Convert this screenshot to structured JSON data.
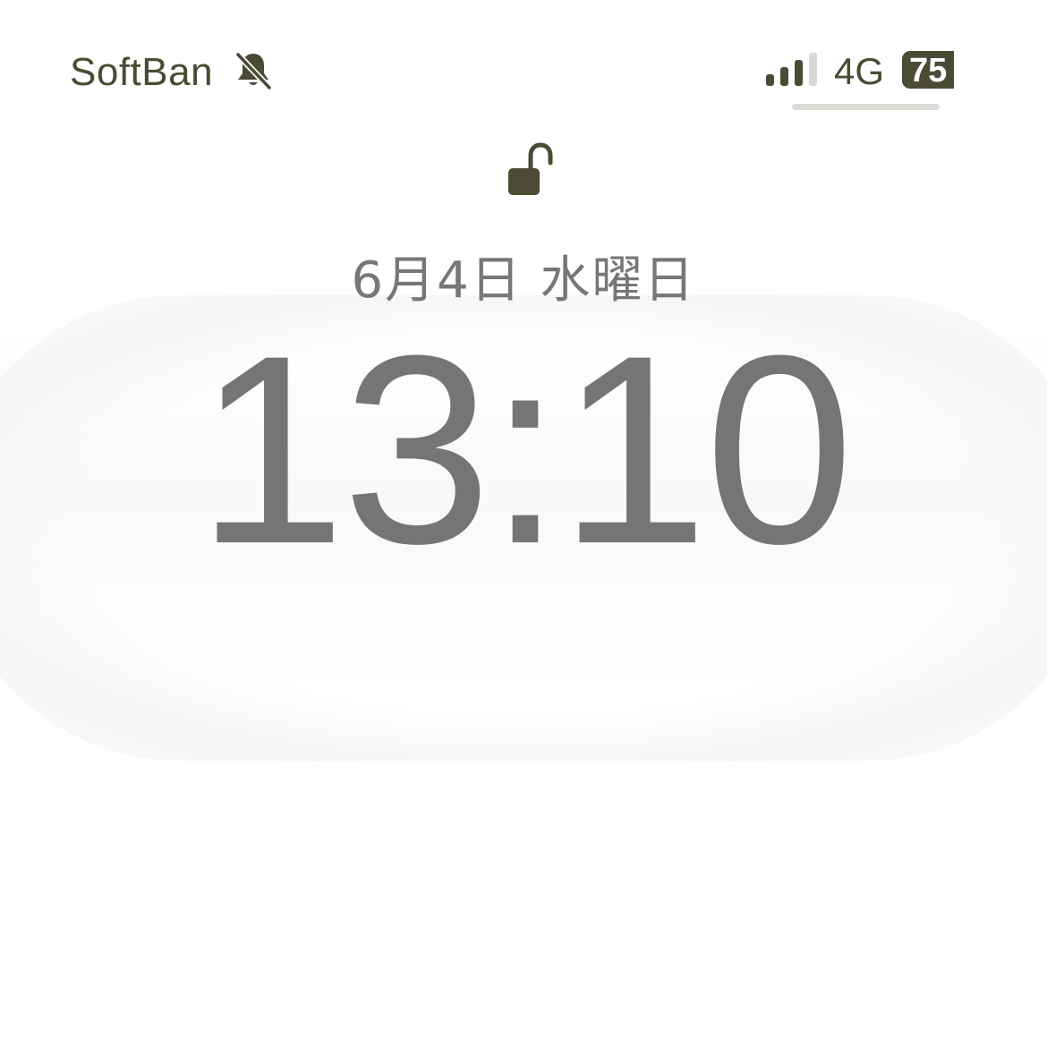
{
  "status_bar": {
    "carrier": "SoftBan",
    "mute_icon": "bell-slash-icon",
    "signal_icon": "cellular-signal-icon",
    "signal_bars_active": 3,
    "signal_bars_total": 4,
    "network": "4G",
    "battery_level": "75",
    "text_color": "#4b4b35"
  },
  "lock_screen": {
    "lock_icon": "unlocked-padlock-icon",
    "date": "6月4日 水曜日",
    "time": "13:10",
    "text_color": "#757575"
  }
}
